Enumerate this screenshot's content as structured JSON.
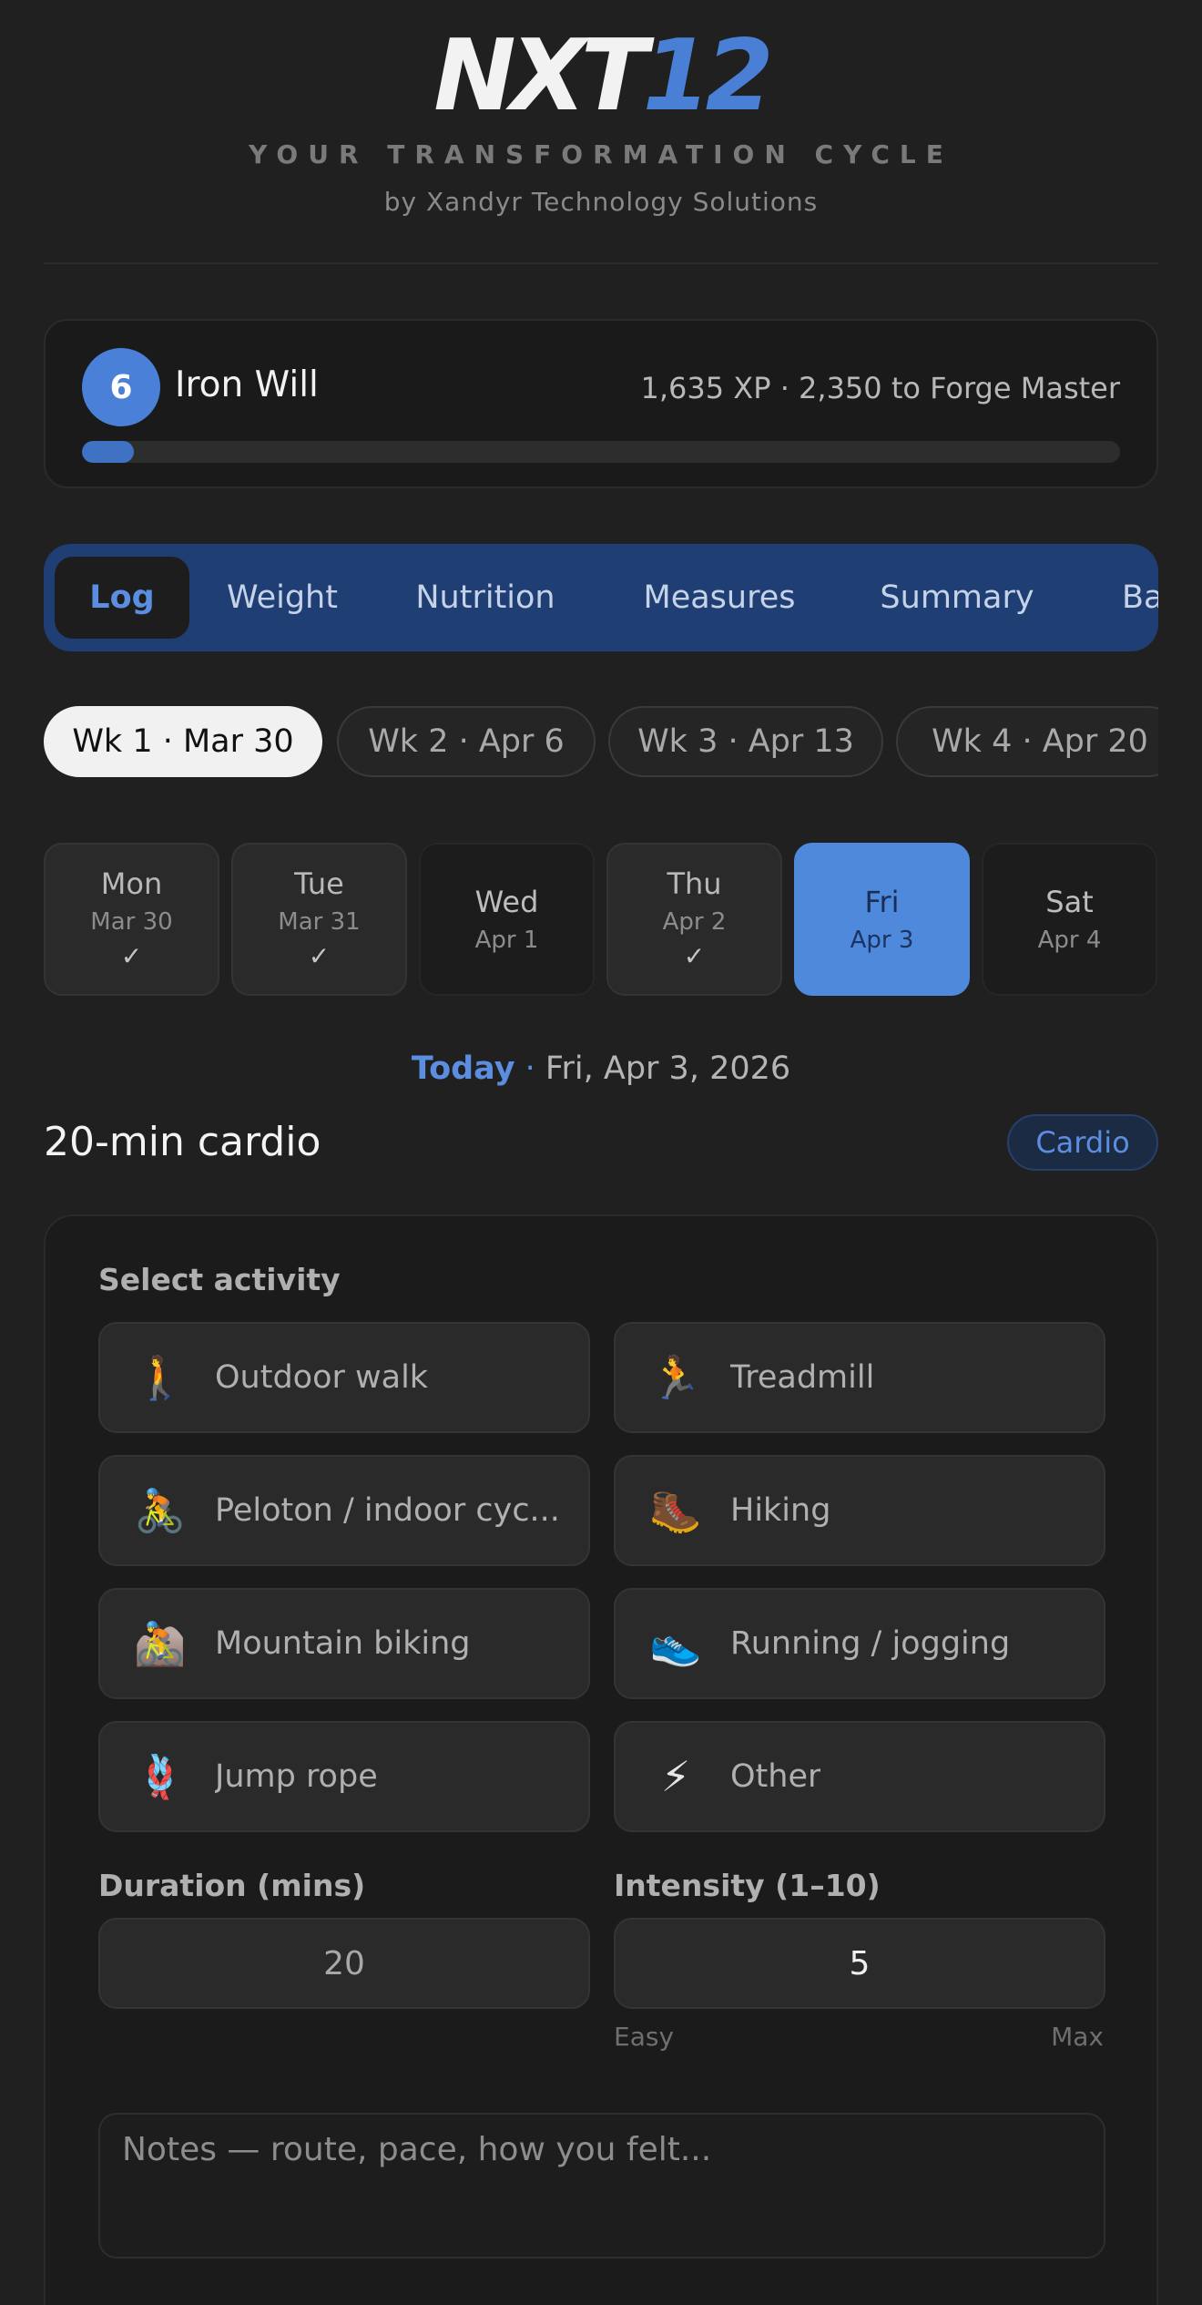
{
  "brand": {
    "logo_main": "NXT",
    "logo_num": "12",
    "tagline": "YOUR TRANSFORMATION CYCLE",
    "byline": "by Xandyr Technology Solutions"
  },
  "level": {
    "number": "6",
    "name": "Iron Will",
    "xp_text": "1,635 XP · 2,350 to Forge Master",
    "progress_fraction": 0.05
  },
  "tabs": [
    {
      "label": "Log",
      "active": true
    },
    {
      "label": "Weight"
    },
    {
      "label": "Nutrition"
    },
    {
      "label": "Measures"
    },
    {
      "label": "Summary"
    },
    {
      "label": "Ba"
    }
  ],
  "weeks": [
    {
      "label": "Wk 1 · Mar 30",
      "active": true
    },
    {
      "label": "Wk 2 · Apr 6"
    },
    {
      "label": "Wk 3 · Apr 13"
    },
    {
      "label": "Wk 4 · Apr 20"
    }
  ],
  "days": [
    {
      "name": "Mon",
      "date": "Mar 30",
      "check": "✓"
    },
    {
      "name": "Tue",
      "date": "Mar 31",
      "check": "✓"
    },
    {
      "name": "Wed",
      "date": "Apr 1",
      "check": ""
    },
    {
      "name": "Thu",
      "date": "Apr 2",
      "check": "✓"
    },
    {
      "name": "Fri",
      "date": "Apr 3",
      "check": "",
      "active": true
    },
    {
      "name": "Sat",
      "date": "Apr 4",
      "check": ""
    }
  ],
  "today": {
    "label": "Today",
    "sep": " · ",
    "date": "Fri, Apr 3, 2026"
  },
  "workout": {
    "title": "20-min cardio",
    "type": "Cardio"
  },
  "form": {
    "select_label": "Select activity",
    "activities": [
      {
        "icon": "🚶",
        "label": "Outdoor walk"
      },
      {
        "icon": "🏃",
        "label": "Treadmill"
      },
      {
        "icon": "🚴",
        "label": "Peloton / indoor cyc..."
      },
      {
        "icon": "🥾",
        "label": "Hiking"
      },
      {
        "icon": "🚵",
        "label": "Mountain biking"
      },
      {
        "icon": "👟",
        "label": "Running / jogging"
      },
      {
        "icon": "🪢",
        "label": "Jump rope"
      },
      {
        "icon": "⚡",
        "label": "Other"
      }
    ],
    "duration_label": "Duration (mins)",
    "duration_value": "20",
    "intensity_label": "Intensity (1–10)",
    "intensity_value": "5",
    "intensity_min": "Easy",
    "intensity_max": "Max",
    "notes_placeholder": "Notes — route, pace, how you felt..."
  }
}
